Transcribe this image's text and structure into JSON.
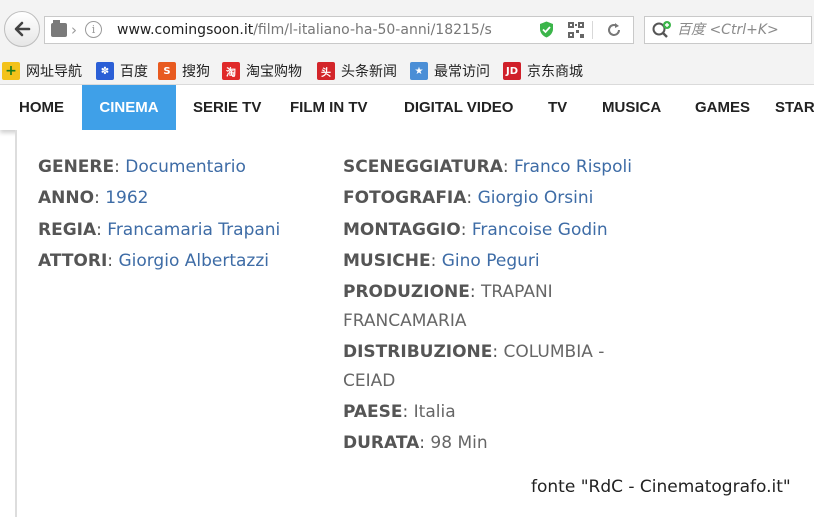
{
  "browser": {
    "url_domain": "www.comingsoon.it",
    "url_path": "/film/l-italiano-ha-50-anni/18215/s",
    "search_placeholder": "百度 <Ctrl+K>"
  },
  "bookmarks": [
    {
      "label": "网址导航",
      "icon": "plus-badge-icon",
      "color": "#f3c21a"
    },
    {
      "label": "百度",
      "icon": "paw-icon",
      "color": "#2b5fd6"
    },
    {
      "label": "搜狗",
      "icon": "sogou-icon",
      "color": "#e85a1f"
    },
    {
      "label": "淘宝购物",
      "icon": "taobao-icon",
      "color": "#e02a2a"
    },
    {
      "label": "头条新闻",
      "icon": "toutiao-icon",
      "color": "#d3252a"
    },
    {
      "label": "最常访问",
      "icon": "frequent-icon",
      "color": "#4a8ed6"
    },
    {
      "label": "京东商城",
      "icon": "jd-icon",
      "color": "#d0202a"
    }
  ],
  "nav": {
    "items": [
      "HOME",
      "CINEMA",
      "SERIE TV",
      "FILM IN TV",
      "DIGITAL VIDEO",
      "TV",
      "MUSICA",
      "GAMES",
      "STAR"
    ],
    "active": "CINEMA",
    "active_color": "#3fa0e8"
  },
  "film": {
    "left": [
      {
        "label": "GENERE",
        "value": "Documentario"
      },
      {
        "label": "ANNO",
        "value": "1962"
      },
      {
        "label": "REGIA",
        "value": "Francamaria Trapani"
      },
      {
        "label": "ATTORI",
        "value": "Giorgio Albertazzi"
      }
    ],
    "right": [
      {
        "label": "SCENEGGIATURA",
        "value": "Franco Rispoli"
      },
      {
        "label": "FOTOGRAFIA",
        "value": "Giorgio Orsini"
      },
      {
        "label": "MONTAGGIO",
        "value": "Francoise Godin"
      },
      {
        "label": "MUSICHE",
        "value": "Gino Peguri"
      },
      {
        "label": "PRODUZIONE",
        "value": "TRAPANI FRANCAMARIA"
      },
      {
        "label": "DISTRIBUZIONE",
        "value": "COLUMBIA - CEIAD"
      },
      {
        "label": "PAESE",
        "value": "Italia"
      },
      {
        "label": "DURATA",
        "value": "98 Min"
      }
    ]
  },
  "source": "fonte \"RdC - Cinematografo.it\"",
  "colors": {
    "link": "#3e6ca6"
  }
}
